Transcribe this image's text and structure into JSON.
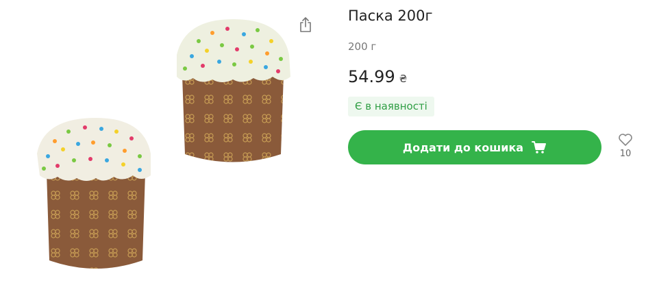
{
  "product": {
    "title": "Паска 200г",
    "weight": "200 г",
    "price": "54.99",
    "currency": "₴",
    "availability": "Є в наявності",
    "image_alt": "Паска 200г"
  },
  "actions": {
    "add_to_cart_label": "Додати до кошика",
    "favorites_count": "10"
  },
  "icons": {
    "share": "share-icon",
    "cart": "cart-icon",
    "heart": "heart-icon"
  },
  "colors": {
    "accent": "#34b34a",
    "availability_text": "#2f9e44",
    "availability_bg": "#eef8ef"
  }
}
